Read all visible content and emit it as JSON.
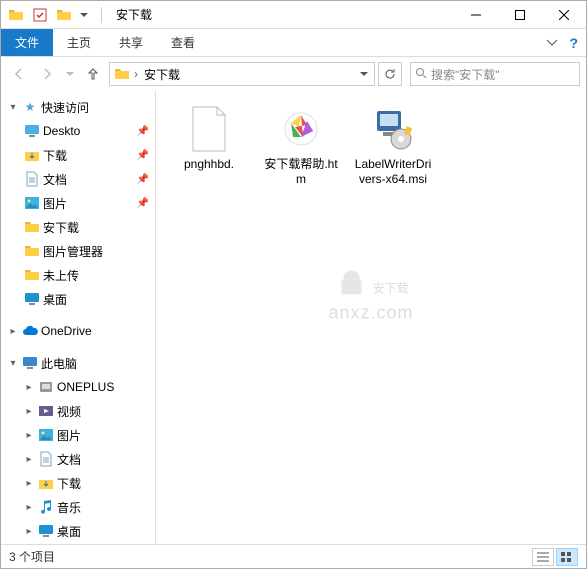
{
  "title": "安下载",
  "ribbon": {
    "file": "文件",
    "home": "主页",
    "share": "共享",
    "view": "查看"
  },
  "breadcrumb": {
    "segment": "安下载"
  },
  "search": {
    "placeholder": "搜索\"安下载\""
  },
  "sidebar": {
    "quick_access": "快速访问",
    "items_qa": [
      {
        "label": "Deskto",
        "icon": "desktop",
        "pinned": true
      },
      {
        "label": "下载",
        "icon": "downloads",
        "pinned": true
      },
      {
        "label": "文档",
        "icon": "documents",
        "pinned": true
      },
      {
        "label": "图片",
        "icon": "pictures",
        "pinned": true
      },
      {
        "label": "安下载",
        "icon": "folder",
        "pinned": false
      },
      {
        "label": "图片管理器",
        "icon": "folder",
        "pinned": false
      },
      {
        "label": "未上传",
        "icon": "folder",
        "pinned": false
      },
      {
        "label": "桌面",
        "icon": "desktop-blue",
        "pinned": false
      }
    ],
    "onedrive": "OneDrive",
    "this_pc": "此电脑",
    "items_pc": [
      {
        "label": "ONEPLUS",
        "icon": "device"
      },
      {
        "label": "视频",
        "icon": "videos"
      },
      {
        "label": "图片",
        "icon": "pictures"
      },
      {
        "label": "文档",
        "icon": "documents"
      },
      {
        "label": "下载",
        "icon": "downloads"
      },
      {
        "label": "音乐",
        "icon": "music"
      },
      {
        "label": "桌面",
        "icon": "desktop-blue"
      }
    ]
  },
  "files": [
    {
      "name": "pnghhbd.",
      "type": "blank"
    },
    {
      "name": "安下载帮助.htm",
      "type": "htm"
    },
    {
      "name": "LabelWriterDrivers-x64.msi",
      "type": "msi"
    }
  ],
  "statusbar": {
    "count": "3 个项目"
  },
  "watermark": {
    "line1": "安下载",
    "line2": "anxz.com"
  }
}
